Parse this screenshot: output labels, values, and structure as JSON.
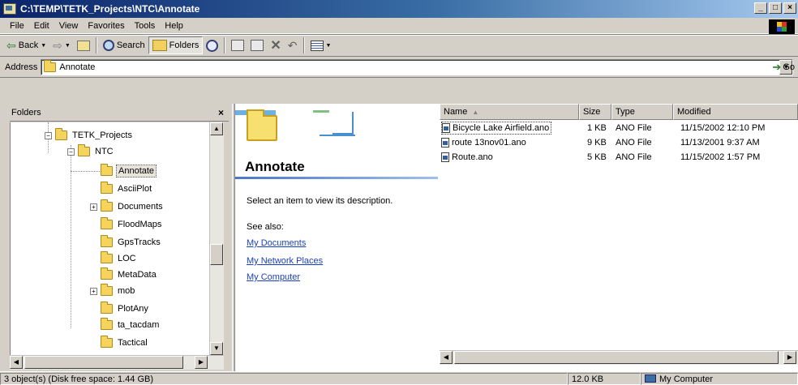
{
  "window": {
    "title": "C:\\TEMP\\TETK_Projects\\NTC\\Annotate"
  },
  "menu": [
    "File",
    "Edit",
    "View",
    "Favorites",
    "Tools",
    "Help"
  ],
  "toolbar": {
    "back_label": "Back",
    "search_label": "Search",
    "folders_label": "Folders"
  },
  "address": {
    "label": "Address",
    "value": "Annotate",
    "go_label": "Go"
  },
  "folders_pane": {
    "title": "Folders",
    "tree": [
      {
        "label": "TETK_Projects",
        "expander": "minus"
      },
      {
        "label": "NTC",
        "expander": "minus"
      },
      {
        "label": "Annotate",
        "selected": true
      },
      {
        "label": "AsciiPlot"
      },
      {
        "label": "Documents",
        "expander": "plus"
      },
      {
        "label": "FloodMaps"
      },
      {
        "label": "GpsTracks"
      },
      {
        "label": "LOC"
      },
      {
        "label": "MetaData"
      },
      {
        "label": "mob",
        "expander": "plus"
      },
      {
        "label": "PlotAny"
      },
      {
        "label": "ta_tacdam"
      },
      {
        "label": "Tactical"
      }
    ]
  },
  "webview": {
    "title": "Annotate",
    "description": "Select an item to view its description.",
    "see_also": "See also:",
    "links": [
      "My Documents",
      "My Network Places",
      "My Computer"
    ]
  },
  "filelist": {
    "columns": [
      "Name",
      "Size",
      "Type",
      "Modified"
    ],
    "rows": [
      {
        "name": "Bicycle Lake Airfield.ano",
        "size": "1 KB",
        "type": "ANO File",
        "modified": "11/15/2002 12:10 PM"
      },
      {
        "name": "route 13nov01.ano",
        "size": "9 KB",
        "type": "ANO File",
        "modified": "11/13/2001 9:37 AM"
      },
      {
        "name": "Route.ano",
        "size": "5 KB",
        "type": "ANO File",
        "modified": "11/15/2002 1:57 PM"
      }
    ]
  },
  "statusbar": {
    "left": "3 object(s) (Disk free space: 1.44 GB)",
    "size": "12.0 KB",
    "location": "My Computer"
  }
}
